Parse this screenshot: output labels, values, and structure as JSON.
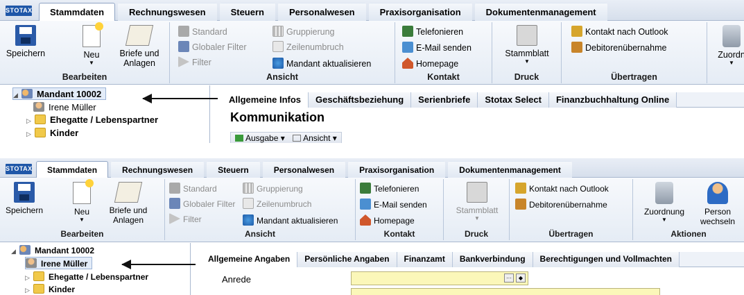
{
  "logo": "STOTAX",
  "tabs_top": [
    "Stammdaten",
    "Rechnungswesen",
    "Steuern",
    "Personalwesen",
    "Praxisorganisation",
    "Dokumentenmanagement"
  ],
  "tabs_bottom": [
    "Stammdaten",
    "Rechnungswesen",
    "Steuern",
    "Personalwesen",
    "Praxisorganisation",
    "Dokumentenmanagement"
  ],
  "ribbon": {
    "bearbeiten": {
      "label": "Bearbeiten",
      "save": "Speichern",
      "new": "Neu",
      "letters_line1": "Briefe und",
      "letters_line2": "Anlagen"
    },
    "ansicht": {
      "label": "Ansicht",
      "standard": "Standard",
      "global_filter": "Globaler Filter",
      "filter": "Filter",
      "grouping": "Gruppierung",
      "line_wrap": "Zeilenumbruch",
      "refresh_client": "Mandant aktualisieren"
    },
    "kontakt": {
      "label": "Kontakt",
      "phone": "Telefonieren",
      "email": "E-Mail senden",
      "homepage": "Homepage"
    },
    "druck": {
      "label": "Druck",
      "stammblatt": "Stammblatt"
    },
    "uebertragen": {
      "label": "Übertragen",
      "outlook": "Kontakt nach Outlook",
      "debitor": "Debitorenübernahme"
    },
    "aktionen": {
      "label": "Aktionen",
      "zuordnung": "Zuordnung",
      "person_line1": "Person",
      "person_line2": "wechseln"
    },
    "zuordnung_truncated": "Zuordn"
  },
  "tree_top": {
    "root": "Mandant 10002",
    "person": "Irene Müller",
    "spouse": "Ehegatte / Lebenspartner",
    "children": "Kinder"
  },
  "tree_bottom": {
    "root": "Mandant 10002",
    "person": "Irene Müller",
    "spouse": "Ehegatte / Lebenspartner",
    "children": "Kinder"
  },
  "content_top": {
    "tabs": [
      "Allgemeine Infos",
      "Geschäftsbeziehung",
      "Serienbriefe",
      "Stotax Select",
      "Finanzbuchhaltung Online"
    ],
    "section": "Kommunikation",
    "toolbar_output": "Ausgabe ▾",
    "toolbar_view": "Ansicht ▾"
  },
  "content_bottom": {
    "tabs": [
      "Allgemeine Angaben",
      "Persönliche Angaben",
      "Finanzamt",
      "Bankverbindung",
      "Berechtigungen und Vollmachten"
    ],
    "field_label": "Anrede"
  },
  "colors": {
    "accent": "#1f57a8",
    "input_yellow": "#fbf7b9"
  }
}
